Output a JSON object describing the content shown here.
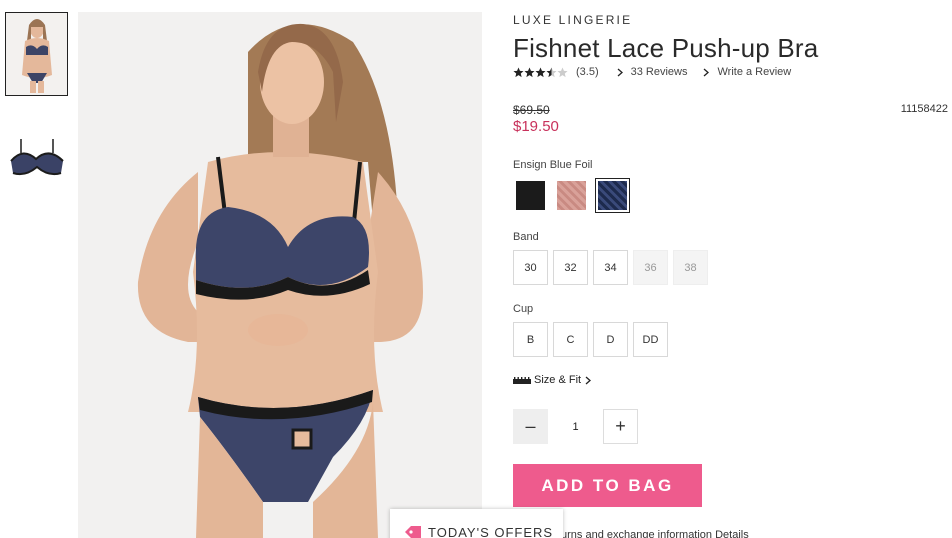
{
  "product": {
    "collection": "LUXE LINGERIE",
    "title": "Fishnet Lace Push-up Bra",
    "rating": 3.5,
    "rating_text": "(3.5)",
    "reviews_link": "33 Reviews",
    "write_review_link": "Write a Review",
    "original_price": "$69.50",
    "sale_price": "$19.50",
    "sku": "11158422"
  },
  "color": {
    "label": "Ensign Blue Foil",
    "swatches": [
      {
        "name": "Black",
        "color": "#1b1b1b",
        "selected": false
      },
      {
        "name": "Pink",
        "color": "#d9a199",
        "selected": false
      },
      {
        "name": "Ensign Blue Foil",
        "color": "#1d2a4d",
        "selected": true
      }
    ]
  },
  "band": {
    "label": "Band",
    "options": [
      {
        "label": "30",
        "available": true
      },
      {
        "label": "32",
        "available": true
      },
      {
        "label": "34",
        "available": true
      },
      {
        "label": "36",
        "available": false
      },
      {
        "label": "38",
        "available": false
      }
    ]
  },
  "cup": {
    "label": "Cup",
    "options": [
      {
        "label": "B",
        "available": true
      },
      {
        "label": "C",
        "available": true
      },
      {
        "label": "D",
        "available": true
      },
      {
        "label": "DD",
        "available": true
      }
    ]
  },
  "size_fit_link": "Size & Fit",
  "quantity": {
    "value": "1",
    "minus": "–",
    "plus": "+"
  },
  "add_to_bag": "ADD TO BAG",
  "offers_tab": "TODAY'S OFFERS",
  "returns_text": "urns and exchange information Details",
  "colors": {
    "accent": "#ee5b8d",
    "sale": "#c8315b"
  }
}
